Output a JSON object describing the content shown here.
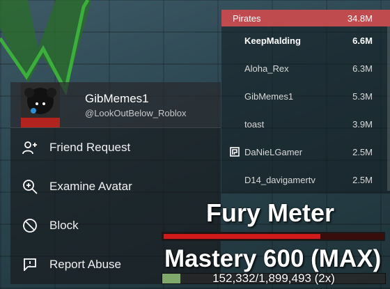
{
  "leaderboard": {
    "team": {
      "name": "Pirates",
      "value": "34.8M",
      "color": "#c04b4e"
    },
    "rows": [
      {
        "name": "KeepMalding",
        "value": "6.6M",
        "me": true
      },
      {
        "name": "Aloha_Rex",
        "value": "6.3M"
      },
      {
        "name": "GibMemes1",
        "value": "5.3M"
      },
      {
        "name": "toast",
        "value": "3.9M"
      },
      {
        "name": "DaNieLGamer",
        "value": "2.5M",
        "icon": "premium-icon"
      },
      {
        "name": "D14_davigamertv",
        "value": "2.5M"
      }
    ]
  },
  "player_menu": {
    "display_name": "GibMemes1",
    "username": "@LookOutBelow_Roblox",
    "items": [
      {
        "label": "Friend Request",
        "icon": "add-friend-icon"
      },
      {
        "label": "Examine Avatar",
        "icon": "magnify-icon"
      },
      {
        "label": "Block",
        "icon": "block-icon"
      },
      {
        "label": "Report Abuse",
        "icon": "flag-icon"
      }
    ]
  },
  "hud": {
    "fury_title": "Fury Meter",
    "fury_level": 0.71,
    "mastery_title": "Mastery 600 (MAX)",
    "xp_text": "152,332/1,899,493 (2x)",
    "xp_fraction": 0.08,
    "fury_color": "#d11b1b",
    "xp_color": "#7fa86b"
  }
}
